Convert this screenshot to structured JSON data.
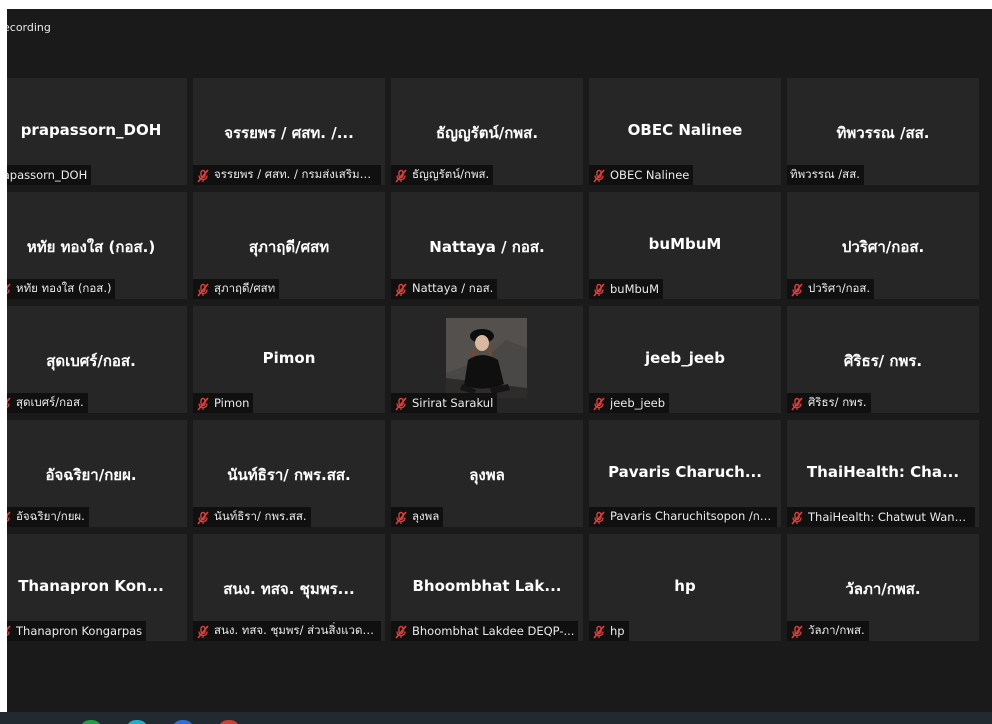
{
  "top_bar": {
    "recording_label": "ecording"
  },
  "tiles": [
    {
      "name": "prapassorn_DOH",
      "footer": "rapassorn_DOH",
      "muted": false
    },
    {
      "name": "จรรยพร / ศสท. /...",
      "footer": "จรรยพร / ศสท. / กรมส่งเสริมค...",
      "muted": true
    },
    {
      "name": "ธัญญรัตน์/กพส.",
      "footer": "ธัญญรัตน์/กพส.",
      "muted": true
    },
    {
      "name": "OBEC Nalinee",
      "footer": "OBEC Nalinee",
      "muted": true
    },
    {
      "name": "ทิพวรรณ /สส.",
      "footer": "ทิพวรรณ /สส.",
      "muted": false
    },
    {
      "name": "หทัย ทองใส (กอส.)",
      "footer": "หทัย ทองใส (กอส.)",
      "muted": true
    },
    {
      "name": "สุภาฤดี/ศสท",
      "footer": "สุภาฤดี/ศสท",
      "muted": true
    },
    {
      "name": "Nattaya / กอส.",
      "footer": "Nattaya / กอส.",
      "muted": true
    },
    {
      "name": "buMbuM",
      "footer": "buMbuM",
      "muted": true
    },
    {
      "name": "ปวริศา/กอส.",
      "footer": "ปวริศา/กอส.",
      "muted": true
    },
    {
      "name": "สุดเบศร์/กอส.",
      "footer": "สุดเบศร์/กอส.",
      "muted": true
    },
    {
      "name": "Pimon",
      "footer": "Pimon",
      "muted": true
    },
    {
      "name": "",
      "footer": "Sirirat Sarakul",
      "muted": true,
      "avatar": true
    },
    {
      "name": "jeeb_jeeb",
      "footer": "jeeb_jeeb",
      "muted": true
    },
    {
      "name": "ศิริธร/ กพร.",
      "footer": "ศิริธร/ กพร.",
      "muted": true
    },
    {
      "name": "อัจฉริยา/กยผ.",
      "footer": "อัจฉริยา/กยผ.",
      "muted": true
    },
    {
      "name": "นันท์ธิรา/ กพร.สส.",
      "footer": "นันท์ธิรา/ กพร.สส.",
      "muted": true
    },
    {
      "name": "ลุงพล",
      "footer": "ลุงพล",
      "muted": true
    },
    {
      "name": "Pavaris  Charuch...",
      "footer": "Pavaris Charuchitsopon /กสป",
      "muted": true
    },
    {
      "name": "ThaiHealth:  Cha...",
      "footer": "ThaiHealth: Chatwut Wang...",
      "muted": true
    },
    {
      "name": "Thanapron  Kon...",
      "footer": "Thanapron Kongarpas",
      "muted": true
    },
    {
      "name": "สนง. ทสจ. ชุมพร...",
      "footer": "สนง. ทสจ. ชุมพร/ ส่วนสิ่งแวดล้...",
      "muted": true
    },
    {
      "name": "Bhoombhat  Lak...",
      "footer": "Bhoombhat Lakdee DEQP-...",
      "muted": true
    },
    {
      "name": "hp",
      "footer": "hp",
      "muted": true
    },
    {
      "name": "วัลภา/กพส.",
      "footer": "วัลภา/กพส.",
      "muted": true
    }
  ],
  "colors": {
    "background": "#1a1a1a",
    "tile": "#262626",
    "muted_mic": "#e0403c"
  },
  "icons": {
    "muted": "mic-muted-icon",
    "avatar": "participant-photo"
  }
}
